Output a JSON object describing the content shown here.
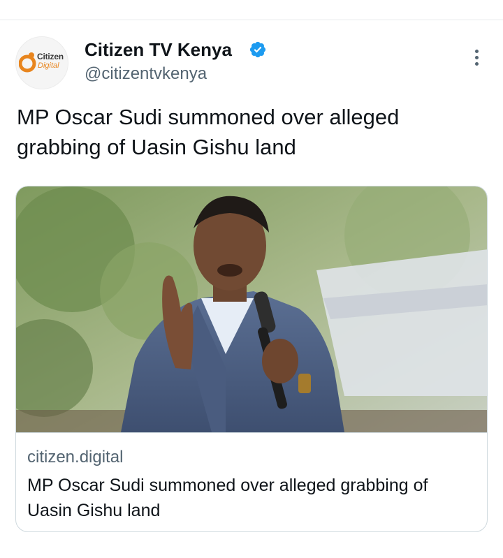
{
  "tweet": {
    "author": {
      "name": "Citizen TV Kenya",
      "handle": "@citizentvkenya",
      "avatar_logo_top": "Citizen",
      "avatar_logo_bottom": "Digital",
      "verified_icon": "verified-badge-icon",
      "verified_color": "#1d9bf0"
    },
    "more_icon": "more-options-icon",
    "text": "MP Oscar Sudi summoned over alleged grabbing of Uasin Gishu land",
    "link_card": {
      "image_icon": "article-photo",
      "domain": "citizen.digital",
      "title": "MP Oscar Sudi summoned over alleged grabbing of Uasin Gishu land"
    }
  },
  "colors": {
    "text_primary": "#0f1419",
    "text_secondary": "#536471",
    "border": "#cfd9de",
    "brand_orange": "#e8851e"
  }
}
